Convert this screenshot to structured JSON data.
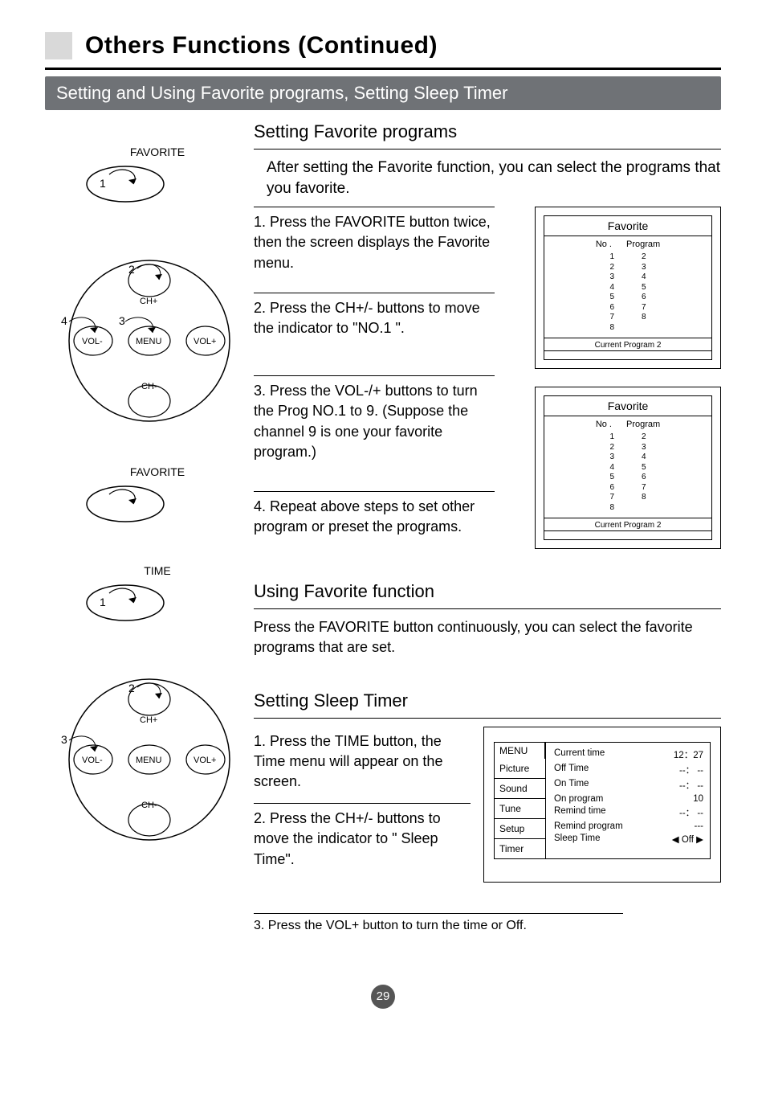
{
  "page_title": "Others Functions (Continued)",
  "subtitle": "Setting and Using Favorite programs, Setting Sleep Timer",
  "page_number": "29",
  "remote": {
    "favorite_label": "FAVORITE",
    "time_label": "TIME",
    "ch_plus": "CH+",
    "ch_minus": "CH-",
    "vol_plus": "VOL+",
    "vol_minus": "VOL-",
    "menu": "MENU",
    "step1": "1",
    "step2": "2",
    "step3": "3",
    "step4": "4"
  },
  "sections": {
    "setting_favorite": {
      "heading": "Setting Favorite programs",
      "intro": "After setting the Favorite function, you can select the programs that you favorite.",
      "steps": {
        "s1": "1. Press the FAVORITE button twice, then the screen displays the Favorite menu.",
        "s2": "2. Press the CH+/- buttons to move the indicator to \"NO.1 \".",
        "s3": "3. Press the VOL-/+ buttons to turn the Prog NO.1 to 9. (Suppose the channel 9 is one your favorite program.)",
        "s4": "4. Repeat above steps to set other program or preset the programs."
      }
    },
    "using_favorite": {
      "heading": "Using Favorite function",
      "body": "Press the FAVORITE button continuously, you can select the favorite programs that are set."
    },
    "sleep_timer": {
      "heading": "Setting Sleep Timer",
      "steps": {
        "s1": "1. Press the TIME button, the Time menu will appear on the screen.",
        "s2": "2. Press the CH+/- buttons to move the indicator to \" Sleep Time\".",
        "s3": "3. Press the VOL+ button to turn the time or Off."
      }
    }
  },
  "osd_favorite": {
    "title": "Favorite",
    "col_no": "No .",
    "col_prog": "Program",
    "nos": [
      "1",
      "2",
      "3",
      "4",
      "5",
      "6",
      "7",
      "8"
    ],
    "progs": [
      "2",
      "3",
      "4",
      "5",
      "6",
      "7",
      "8",
      ""
    ],
    "footer": "Current Program  2"
  },
  "timer_menu": {
    "menu_label": "MENU",
    "tabs": [
      "Picture",
      "Sound",
      "Tune",
      "Setup",
      "Timer"
    ],
    "rows": [
      {
        "label": "Current time",
        "value": "12：27"
      },
      {
        "label": "Off  Time",
        "value": "--：  --"
      },
      {
        "label": "On  Time",
        "value": "--：  --"
      },
      {
        "label": "On program",
        "value": "10"
      },
      {
        "label": "Remind time",
        "value": "--：  --"
      },
      {
        "label": "Remind program",
        "value": "---"
      },
      {
        "label": "Sleep Time",
        "value": "◀  Off  ▶"
      }
    ]
  }
}
